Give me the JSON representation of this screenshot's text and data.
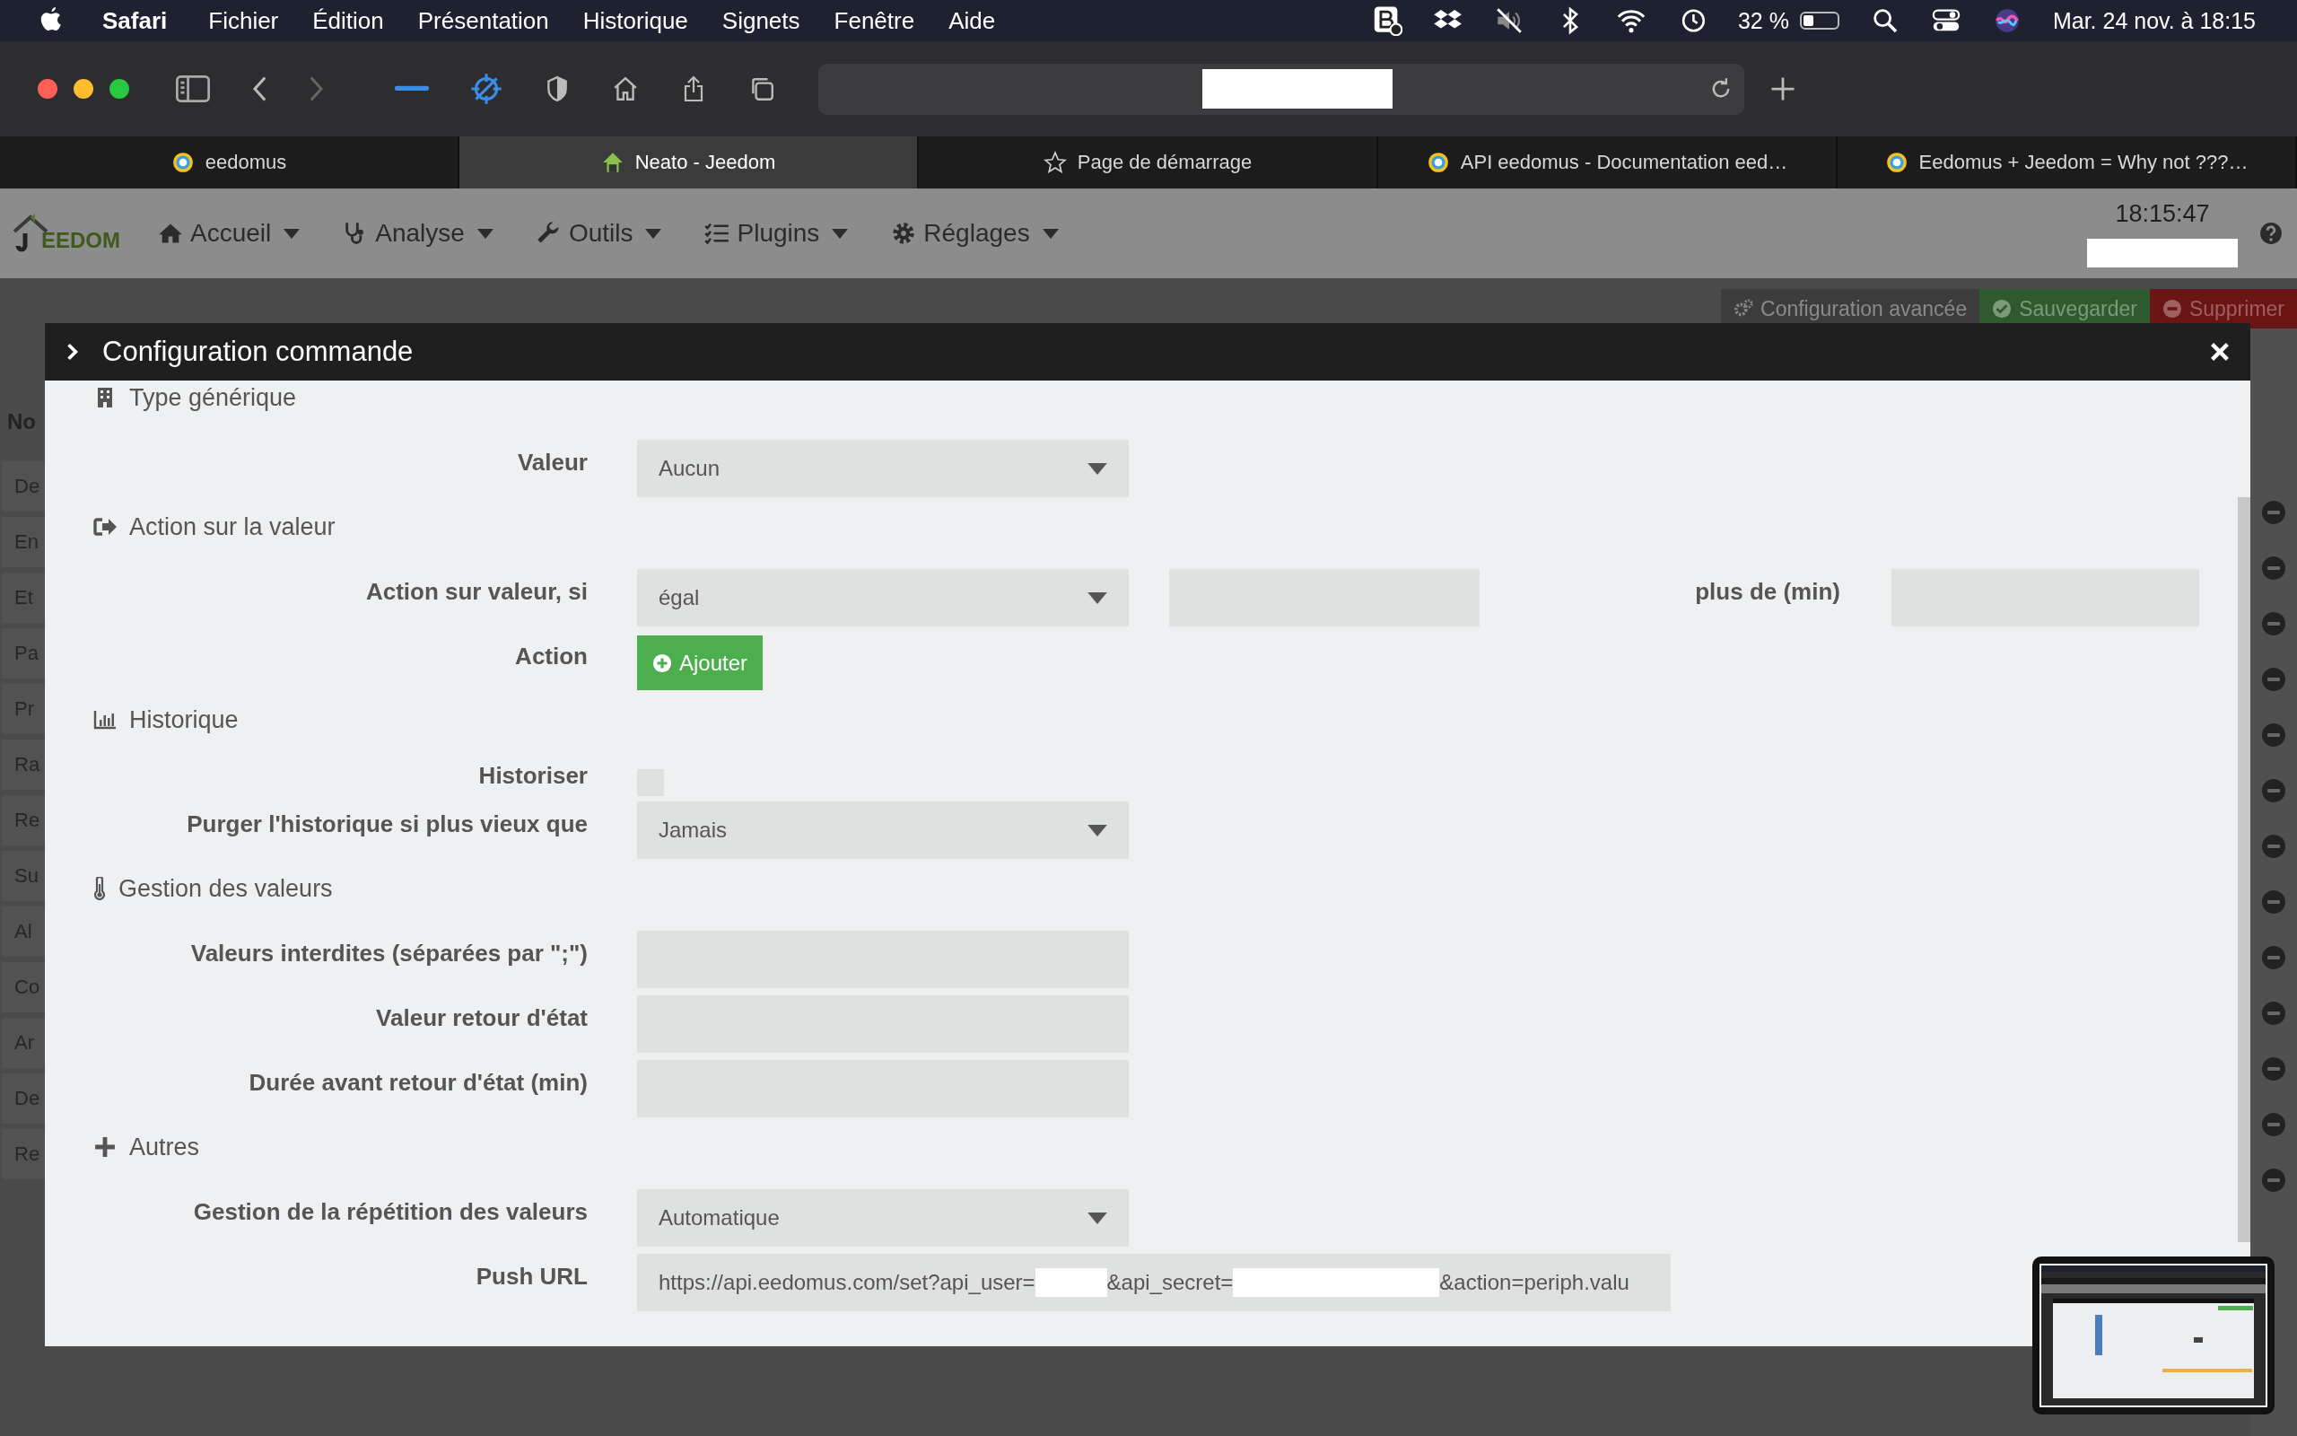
{
  "menubar": {
    "app": "Safari",
    "menus": [
      "Fichier",
      "Édition",
      "Présentation",
      "Historique",
      "Signets",
      "Fenêtre",
      "Aide"
    ],
    "battery": {
      "reading": "32 %",
      "level": 0.32
    },
    "clock": "Mar. 24 nov. à 18:15"
  },
  "browser": {
    "tabs": [
      {
        "title": "eedomus",
        "selected": false
      },
      {
        "title": "Neato - Jeedom",
        "selected": true
      },
      {
        "title": "Page de démarrage",
        "selected": false
      },
      {
        "title": "API eedomus - Documentation eed…",
        "selected": false
      },
      {
        "title": "Eedomus + Jeedom = Why not ???…",
        "selected": false
      }
    ]
  },
  "jeedom_nav": {
    "logo": "EEDOM",
    "menus": [
      "Accueil",
      "Analyse",
      "Outils",
      "Plugins",
      "Réglages"
    ],
    "time": "18:15:47"
  },
  "page_actions": [
    {
      "label": "Configuration avancée",
      "kind": "config"
    },
    {
      "label": "Sauvegarder",
      "kind": "save"
    },
    {
      "label": "Supprimer",
      "kind": "delete"
    }
  ],
  "command_list": {
    "header": "No",
    "rows": [
      "De",
      "En",
      "Et",
      "Pa",
      "Pr",
      "Ra",
      "Re",
      "Su",
      "Al",
      "Co",
      "Ar",
      "De",
      "Re"
    ]
  },
  "modal": {
    "title": "Configuration commande",
    "sections": [
      {
        "title": "Type générique",
        "rows": [
          {
            "kind": "select",
            "label": "Valeur",
            "value": "Aucun"
          }
        ]
      },
      {
        "title": "Action sur la valeur",
        "rows": [
          {
            "kind": "condition",
            "label": "Action sur valeur, si",
            "value": "égal",
            "label_2": "plus de (min)"
          },
          {
            "kind": "button",
            "label": "Action",
            "value": "Ajouter"
          }
        ]
      },
      {
        "title": "Historique",
        "rows": [
          {
            "kind": "checkbox",
            "label": "Historiser",
            "checked": false
          },
          {
            "kind": "select",
            "label": "Purger l'historique si plus vieux que",
            "value": "Jamais"
          }
        ]
      },
      {
        "title": "Gestion des valeurs",
        "rows": [
          {
            "kind": "text",
            "label": "Valeurs interdites (séparées par \";\")"
          },
          {
            "kind": "text",
            "label": "Valeur retour d'état"
          },
          {
            "kind": "text",
            "label": "Durée avant retour d'état (min)"
          }
        ]
      },
      {
        "title": "Autres",
        "rows": [
          {
            "kind": "select",
            "label": "Gestion de la répétition des valeurs",
            "value": "Automatique"
          },
          {
            "kind": "url",
            "label": "Push URL",
            "parts": [
              {
                "kind": "text",
                "text": "https://api.eedomus.com/set?api_user="
              },
              {
                "kind": "redacted"
              },
              {
                "kind": "text",
                "text": "&api_secret="
              },
              {
                "kind": "redacted"
              },
              {
                "kind": "text",
                "text": "&action=periph.valu"
              }
            ]
          }
        ]
      }
    ]
  }
}
